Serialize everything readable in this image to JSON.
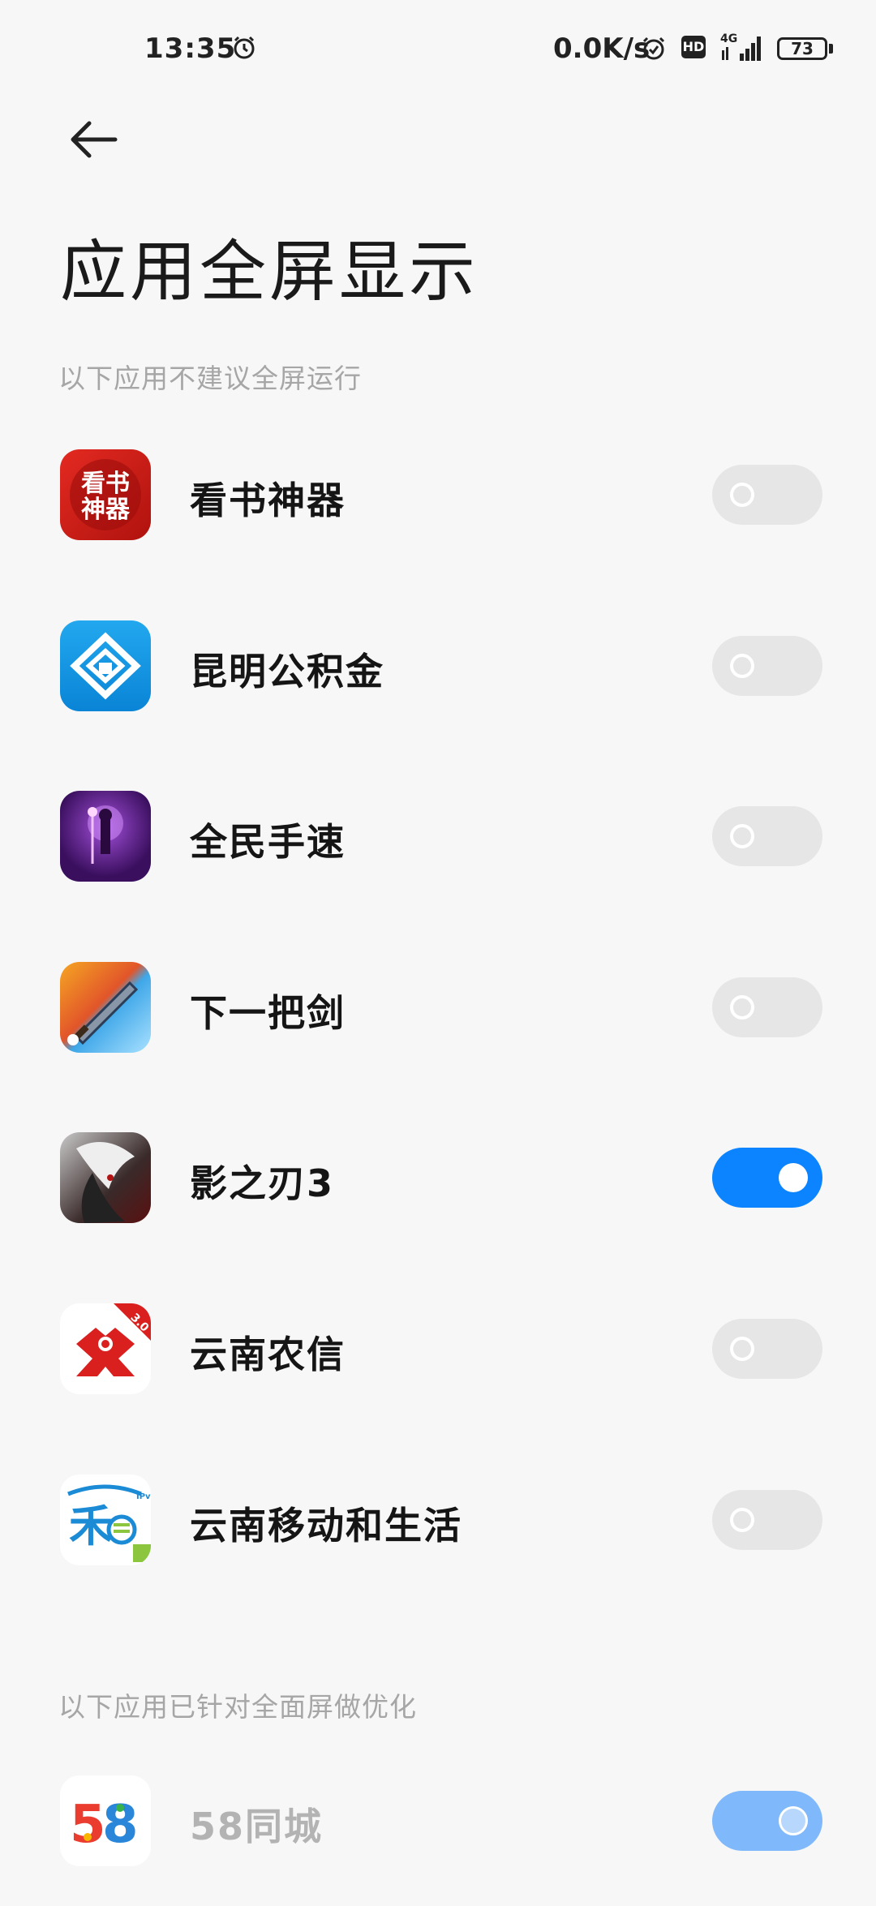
{
  "status_bar": {
    "time": "13:35",
    "net_speed": "0.0K/s",
    "battery": "73",
    "hd": "HD",
    "network": "4G"
  },
  "page": {
    "title": "应用全屏显示"
  },
  "sections": [
    {
      "header": "以下应用不建议全屏运行",
      "apps": [
        {
          "name": "看书神器",
          "icon_text": "看书\n神器",
          "enabled": false
        },
        {
          "name": "昆明公积金",
          "enabled": false
        },
        {
          "name": "全民手速",
          "enabled": false
        },
        {
          "name": "下一把剑",
          "enabled": false
        },
        {
          "name": "影之刃3",
          "enabled": true
        },
        {
          "name": "云南农信",
          "icon_badge": "3.0",
          "enabled": false
        },
        {
          "name": "云南移动和生活",
          "icon_badge": "IPv6",
          "enabled": false
        }
      ]
    },
    {
      "header": "以下应用已针对全面屏做优化",
      "apps": [
        {
          "name": "58同城",
          "icon_text": "58",
          "enabled": true,
          "disabled": true
        }
      ]
    }
  ],
  "colors": {
    "accent": "#0d84ff",
    "toggle_off": "#e6e6e6",
    "section_header": "#a6a6a6",
    "background": "#f7f7f7"
  }
}
